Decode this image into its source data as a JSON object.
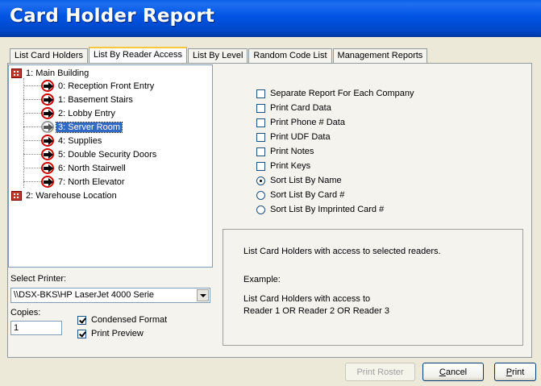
{
  "window": {
    "title": "Card Holder Report"
  },
  "tabs": [
    {
      "label": "List Card Holders",
      "active": false
    },
    {
      "label": "List By Reader Access",
      "active": true
    },
    {
      "label": "List By Level",
      "active": false
    },
    {
      "label": "Random Code List",
      "active": false
    },
    {
      "label": "Management Reports",
      "active": false
    }
  ],
  "tree": {
    "locations": [
      {
        "label": "1:  Main Building",
        "icon": "building-icon",
        "readers": [
          {
            "label": "0: Reception Front Entry",
            "icon": "door-reader-icon",
            "selected": false
          },
          {
            "label": "1: Basement Stairs",
            "icon": "door-reader-icon",
            "selected": false
          },
          {
            "label": "2: Lobby Entry",
            "icon": "door-reader-icon",
            "selected": false
          },
          {
            "label": "3: Server Room",
            "icon": "door-reader-icon",
            "selected": true
          },
          {
            "label": "4: Supplies",
            "icon": "door-reader-icon",
            "selected": false
          },
          {
            "label": "5: Double Security Doors",
            "icon": "door-reader-icon",
            "selected": false
          },
          {
            "label": "6: North Stairwell",
            "icon": "door-reader-icon",
            "selected": false
          },
          {
            "label": "7: North Elevator",
            "icon": "door-reader-icon",
            "selected": false
          }
        ]
      },
      {
        "label": "2:  Warehouse Location",
        "icon": "building-icon",
        "readers": []
      }
    ]
  },
  "printer": {
    "label": "Select Printer:",
    "value": "\\\\DSX-BKS\\HP LaserJet 4000 Serie"
  },
  "copies": {
    "label": "Copies:",
    "value": "1"
  },
  "format_options": [
    {
      "label": "Condensed Format",
      "checked": true
    },
    {
      "label": "Print Preview",
      "checked": true
    }
  ],
  "report_options": [
    {
      "label": "Separate Report For Each Company",
      "checked": false
    },
    {
      "label": "Print Card Data",
      "checked": false
    },
    {
      "label": "Print Phone # Data",
      "checked": false
    },
    {
      "label": "Print UDF Data",
      "checked": false
    },
    {
      "label": "Print Notes",
      "checked": false
    },
    {
      "label": "Print Keys",
      "checked": false
    }
  ],
  "sort_options": [
    {
      "label": "Sort List By Name",
      "selected": true
    },
    {
      "label": "Sort List By Card #",
      "selected": false
    },
    {
      "label": "Sort List By Imprinted Card #",
      "selected": false
    }
  ],
  "description": {
    "line1": "List Card Holders with access to selected readers.",
    "example_label": "Example:",
    "example_line1": "List Card Holders with access to",
    "example_line2": "Reader 1 OR Reader 2 OR Reader 3"
  },
  "buttons": {
    "print_roster": "Print Roster",
    "cancel_first": "C",
    "cancel_rest": "ancel",
    "print_first": "P",
    "print_rest": "rint"
  },
  "colors": {
    "titlebar": "#0054e3",
    "selection": "#316ac5",
    "active_tab_accent": "#ffc83c"
  }
}
